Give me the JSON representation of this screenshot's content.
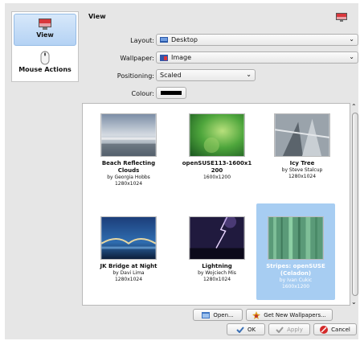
{
  "sidebar": {
    "items": [
      {
        "label": "View",
        "icon": "monitor-icon"
      },
      {
        "label": "Mouse Actions",
        "icon": "mouse-icon"
      }
    ]
  },
  "page": {
    "title": "View"
  },
  "form": {
    "layout": {
      "label": "Layout:",
      "value": "Desktop"
    },
    "wallpaper": {
      "label": "Wallpaper:",
      "value": "Image"
    },
    "positioning": {
      "label": "Positioning:",
      "value": "Scaled"
    },
    "colour": {
      "label": "Colour:",
      "value": "#000000"
    }
  },
  "wallpapers": [
    {
      "name": "Beach Reflecting Clouds",
      "author": "by Georgia Hobbs",
      "size": "1280x1024"
    },
    {
      "name": "openSUSE113-1600x1 200",
      "author": "",
      "size": "1600x1200"
    },
    {
      "name": "Icy Tree",
      "author": "by Steve Stalcup",
      "size": "1280x1024"
    },
    {
      "name": "JK Bridge at Night",
      "author": "by Davi Lima",
      "size": "1280x1024"
    },
    {
      "name": "Lightning",
      "author": "by Wojciech Mis",
      "size": "1280x1024"
    },
    {
      "name": "Stripes: openSUSE (Celadon)",
      "author": "by Ivan Cukic",
      "size": "1600x1200"
    }
  ],
  "buttons": {
    "open": "Open...",
    "get_new": "Get New Wallpapers...",
    "ok": "OK",
    "apply": "Apply",
    "cancel": "Cancel"
  },
  "colors": {
    "selection": "#a7cdf2",
    "accent": "#3a6fb4"
  }
}
